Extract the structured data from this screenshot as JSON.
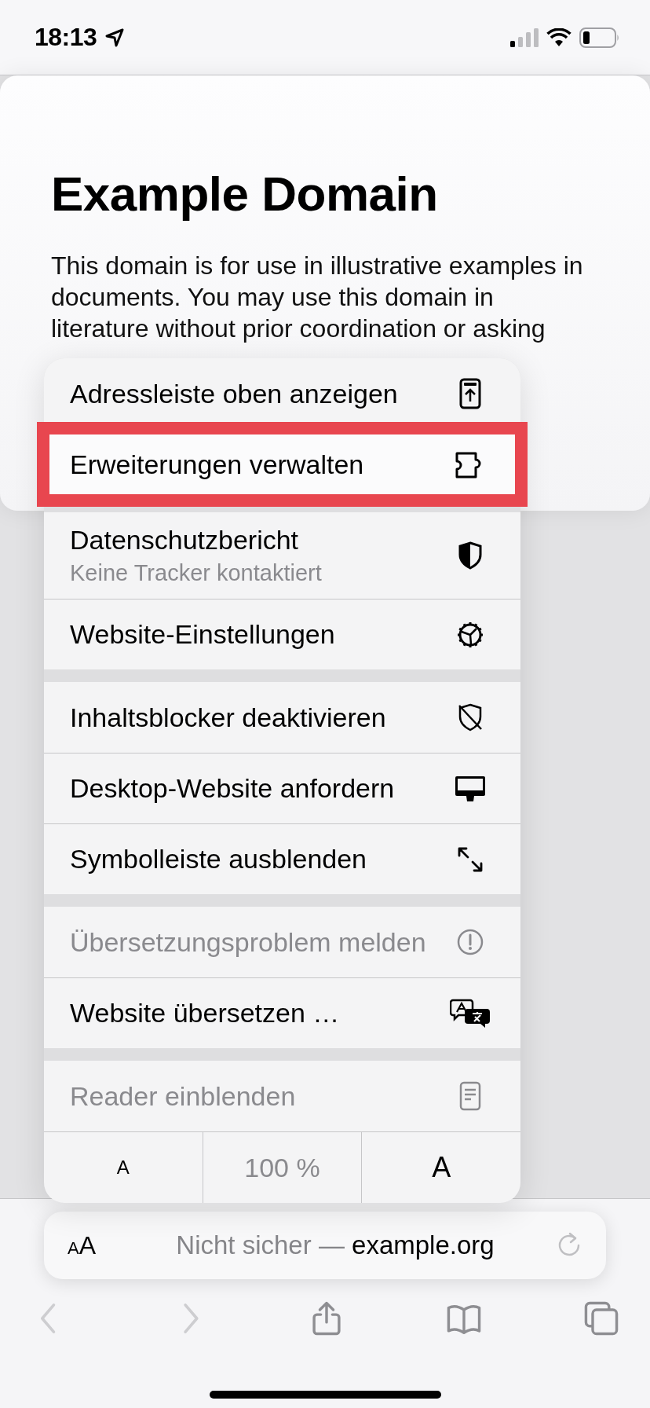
{
  "status_bar": {
    "time": "18:13"
  },
  "page": {
    "heading": "Example Domain",
    "paragraph": "This domain is for use in illustrative examples in documents. You may use this domain in literature without prior coordination or asking"
  },
  "menu": {
    "sections": [
      {
        "items": [
          {
            "kind": "item",
            "label": "Adressleiste oben anzeigen",
            "disabled": false,
            "highlighted": false
          },
          {
            "kind": "item",
            "label": "Erweiterungen verwalten",
            "disabled": false,
            "highlighted": true
          }
        ]
      },
      {
        "items": [
          {
            "kind": "item",
            "label": "Datenschutzbericht",
            "subtitle": "Keine Tracker kontaktiert",
            "disabled": false,
            "highlighted": false
          },
          {
            "kind": "item",
            "label": "Website-Einstellungen",
            "disabled": false,
            "highlighted": false
          }
        ]
      },
      {
        "items": [
          {
            "kind": "item",
            "label": "Inhaltsblocker deaktivieren",
            "disabled": false,
            "highlighted": false
          },
          {
            "kind": "item",
            "label": "Desktop-Website anfordern",
            "disabled": false,
            "highlighted": false
          },
          {
            "kind": "item",
            "label": "Symbolleiste ausblenden",
            "disabled": false,
            "highlighted": false
          }
        ]
      },
      {
        "items": [
          {
            "kind": "item",
            "label": "Übersetzungsproblem melden",
            "disabled": true,
            "highlighted": false
          },
          {
            "kind": "item",
            "label": "Website übersetzen …",
            "disabled": false,
            "highlighted": false
          }
        ]
      },
      {
        "items": [
          {
            "kind": "item",
            "label": "Reader einblenden",
            "disabled": true,
            "highlighted": false
          },
          {
            "kind": "zoom",
            "decrease": "A",
            "zoom_value": "100 %",
            "increase": "A"
          }
        ]
      }
    ]
  },
  "address_bar": {
    "format_button": "AA",
    "security": "Nicht sicher —",
    "domain": "example.org"
  },
  "toolbar": {
    "buttons": [
      {
        "disabled": true
      },
      {
        "disabled": true
      },
      {
        "disabled": false
      },
      {
        "disabled": false
      },
      {
        "disabled": false
      }
    ]
  }
}
